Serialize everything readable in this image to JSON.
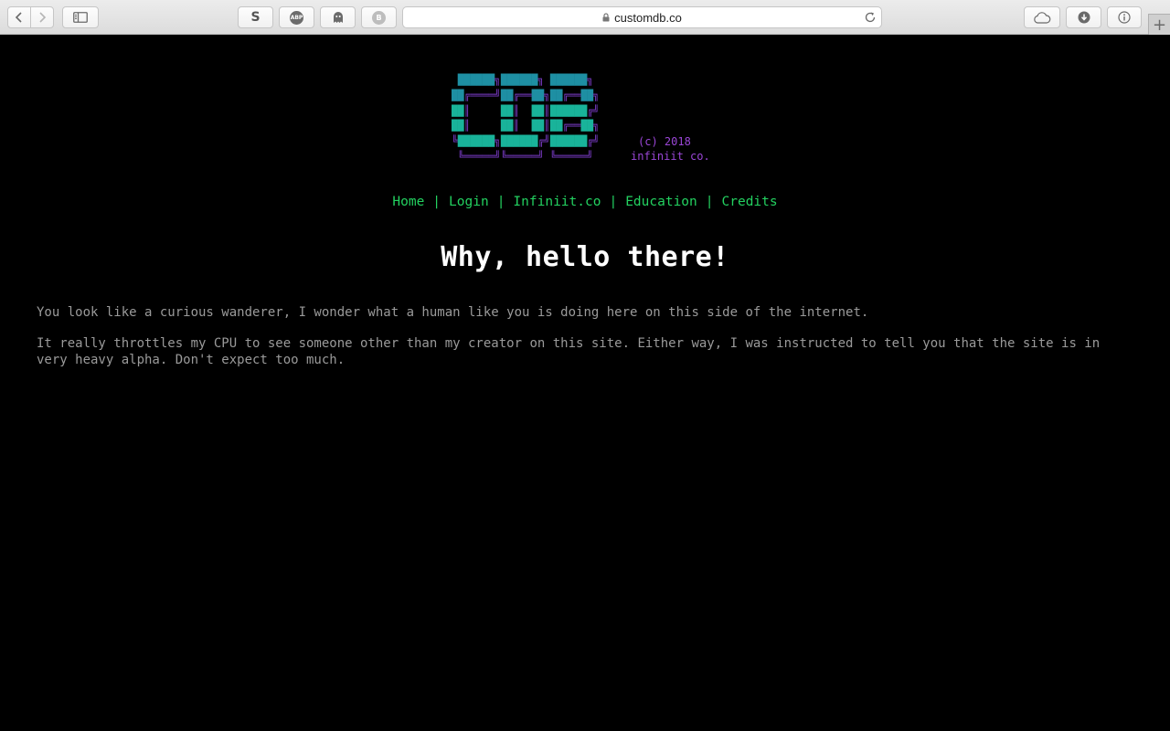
{
  "browser": {
    "url": "customdb.co",
    "extensions": [
      {
        "name": "s-extension",
        "label": "S"
      },
      {
        "name": "adblock-plus",
        "label": "ABP"
      },
      {
        "name": "ghostery",
        "label": ""
      },
      {
        "name": "b-extension",
        "label": "B"
      }
    ],
    "new_tab_label": "+"
  },
  "logo": {
    "copyright_line1": "(c) 2018",
    "copyright_line2": "infiniit co.",
    "colors": {
      "frame": "#7b3cc7",
      "blocks_top": "#1e8fa3",
      "blocks_bottom": "#19b39a"
    }
  },
  "nav": {
    "items": [
      {
        "label": "Home"
      },
      {
        "label": "Login"
      },
      {
        "label": "Infiniit.co"
      },
      {
        "label": "Education"
      },
      {
        "label": "Credits"
      }
    ],
    "separator": "|",
    "color": "#23d160"
  },
  "main": {
    "headline": "Why, hello there!",
    "paragraphs": [
      "You look like a curious wanderer, I wonder what a human like you is doing here on this side of the internet.",
      "It really throttles my CPU to see someone other than my creator on this site. Either way, I was instructed to tell you that the site is in very heavy alpha. Don't expect too much."
    ]
  }
}
